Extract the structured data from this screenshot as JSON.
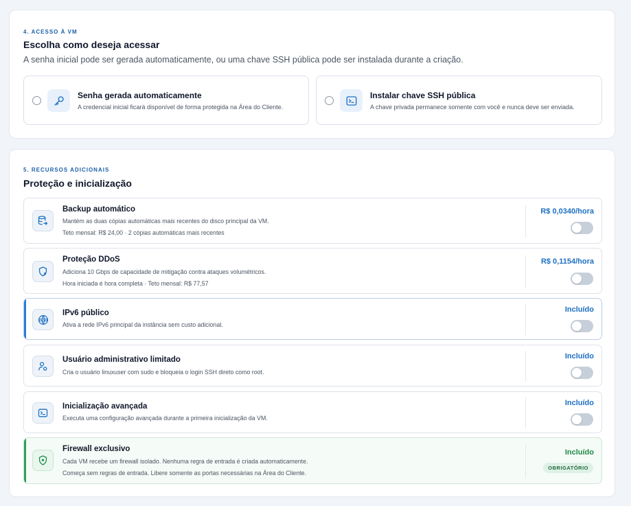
{
  "access": {
    "eyebrow": "4. ACESSO À VM",
    "title": "Escolha como deseja acessar",
    "description": "A senha inicial pode ser gerada automaticamente, ou uma chave SSH pública pode ser instalada durante a criação.",
    "options": [
      {
        "title": "Senha gerada automaticamente",
        "description": "A credencial inicial ficará disponível de forma protegida na Área do Cliente.",
        "icon": "key-icon"
      },
      {
        "title": "Instalar chave SSH pública",
        "description": "A chave privada permanece somente com você e nunca deve ser enviada.",
        "icon": "terminal-icon"
      }
    ]
  },
  "resources": {
    "eyebrow": "5. RECURSOS ADICIONAIS",
    "title": "Proteção e inicialização",
    "items": [
      {
        "title": "Backup automático",
        "description": "Mantém as duas cópias automáticas mais recentes do disco principal da VM.",
        "sub": "Teto mensal: R$ 24,00 · 2 cópias automáticas mais recentes",
        "price": "R$ 0,0340/hora",
        "icon": "database-backup-icon",
        "enabled": false
      },
      {
        "title": "Proteção DDoS",
        "description": "Adiciona 10 Gbps de capacidade de mitigação contra ataques volumétricos.",
        "sub": "Hora iniciada é hora completa · Teto mensal: R$ 77,57",
        "price": "R$ 0,1154/hora",
        "icon": "shield-refresh-icon",
        "enabled": false
      },
      {
        "title": "IPv6 público",
        "description": "Ativa a rede IPv6 principal da instância sem custo adicional.",
        "price": "Incluído",
        "icon": "globe-www-icon",
        "enabled": false
      },
      {
        "title": "Usuário administrativo limitado",
        "description": "Cria o usuário linuxuser com sudo e bloqueia o login SSH direto como root.",
        "price": "Incluído",
        "icon": "user-lock-icon",
        "enabled": false
      },
      {
        "title": "Inicialização avançada",
        "description": "Executa uma configuração avançada durante a primeira inicialização da VM.",
        "price": "Incluído",
        "icon": "terminal-icon",
        "enabled": false
      },
      {
        "title": "Firewall exclusivo",
        "description": "Cada VM recebe um firewall isolado. Nenhuma regra de entrada é criada automaticamente.",
        "sub": "Começa sem regras de entrada. Libere somente as portas necessárias na Área do Cliente.",
        "price": "Incluído",
        "badge": "OBRIGATÓRIO",
        "icon": "shield-check-icon"
      }
    ]
  },
  "colors": {
    "accent": "#1d6fc2",
    "success": "#1f8a49",
    "toggle_off": "#c7cfda"
  }
}
